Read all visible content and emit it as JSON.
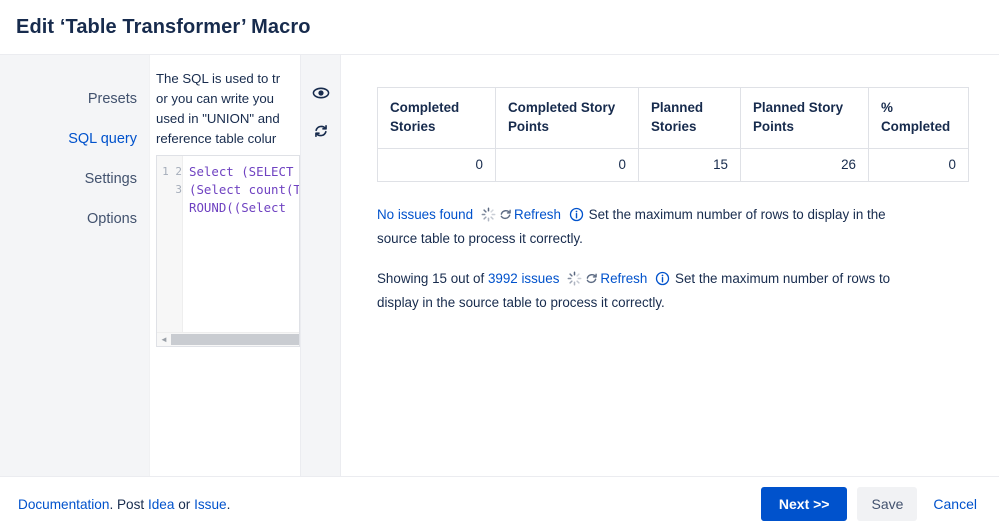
{
  "header": {
    "title": "Edit ‘Table Transformer’ Macro"
  },
  "sidebar": {
    "items": [
      {
        "label": "Presets",
        "active": false
      },
      {
        "label": "SQL query",
        "active": true
      },
      {
        "label": "Settings",
        "active": false
      },
      {
        "label": "Options",
        "active": false
      }
    ]
  },
  "editor": {
    "description": "The SQL is used to tr\nor you can write you\nused in \"UNION\" and\nreference table colur",
    "line_numbers": "1\n2\n3",
    "code": "Select (SELECT\n(Select count(T\nROUND((Select",
    "rail": {
      "preview_icon": "eye-icon",
      "refresh_icon": "refresh-icon"
    },
    "scrollbar_arrow": "◄"
  },
  "preview": {
    "table": {
      "columns": [
        "Completed Stories",
        "Completed Story Points",
        "Planned Stories",
        "Planned Story Points",
        "% Completed"
      ],
      "rows": [
        [
          "0",
          "0",
          "15",
          "26",
          "0"
        ]
      ]
    },
    "status_rows": [
      {
        "prefix": "",
        "link": "No issues found",
        "suffix": "",
        "spinner_icon": "loading-spinner-icon",
        "refresh_icon": "refresh-icon",
        "refresh_label": "Refresh",
        "info_icon": "info-icon",
        "info_text": "Set the maximum number of rows to display in the source table to process it correctly."
      },
      {
        "prefix": "Showing 15 out of ",
        "link": "3992 issues",
        "suffix": "",
        "spinner_icon": "loading-spinner-icon",
        "refresh_icon": "refresh-icon",
        "refresh_label": "Refresh",
        "info_icon": "info-icon",
        "info_text": "Set the maximum number of rows to display in the source table to process it correctly."
      }
    ]
  },
  "footer": {
    "documentation_label": "Documentation",
    "post_label": ". Post ",
    "idea_label": "Idea",
    "or_label": " or ",
    "issue_label": "Issue",
    "period_label": ".",
    "next_label": "Next >>",
    "save_label": "Save",
    "cancel_label": "Cancel"
  },
  "colors": {
    "accent": "#0052cc",
    "text": "#172b4d",
    "sidebar_bg": "#f4f5f7",
    "border": "#dfe1e6"
  }
}
